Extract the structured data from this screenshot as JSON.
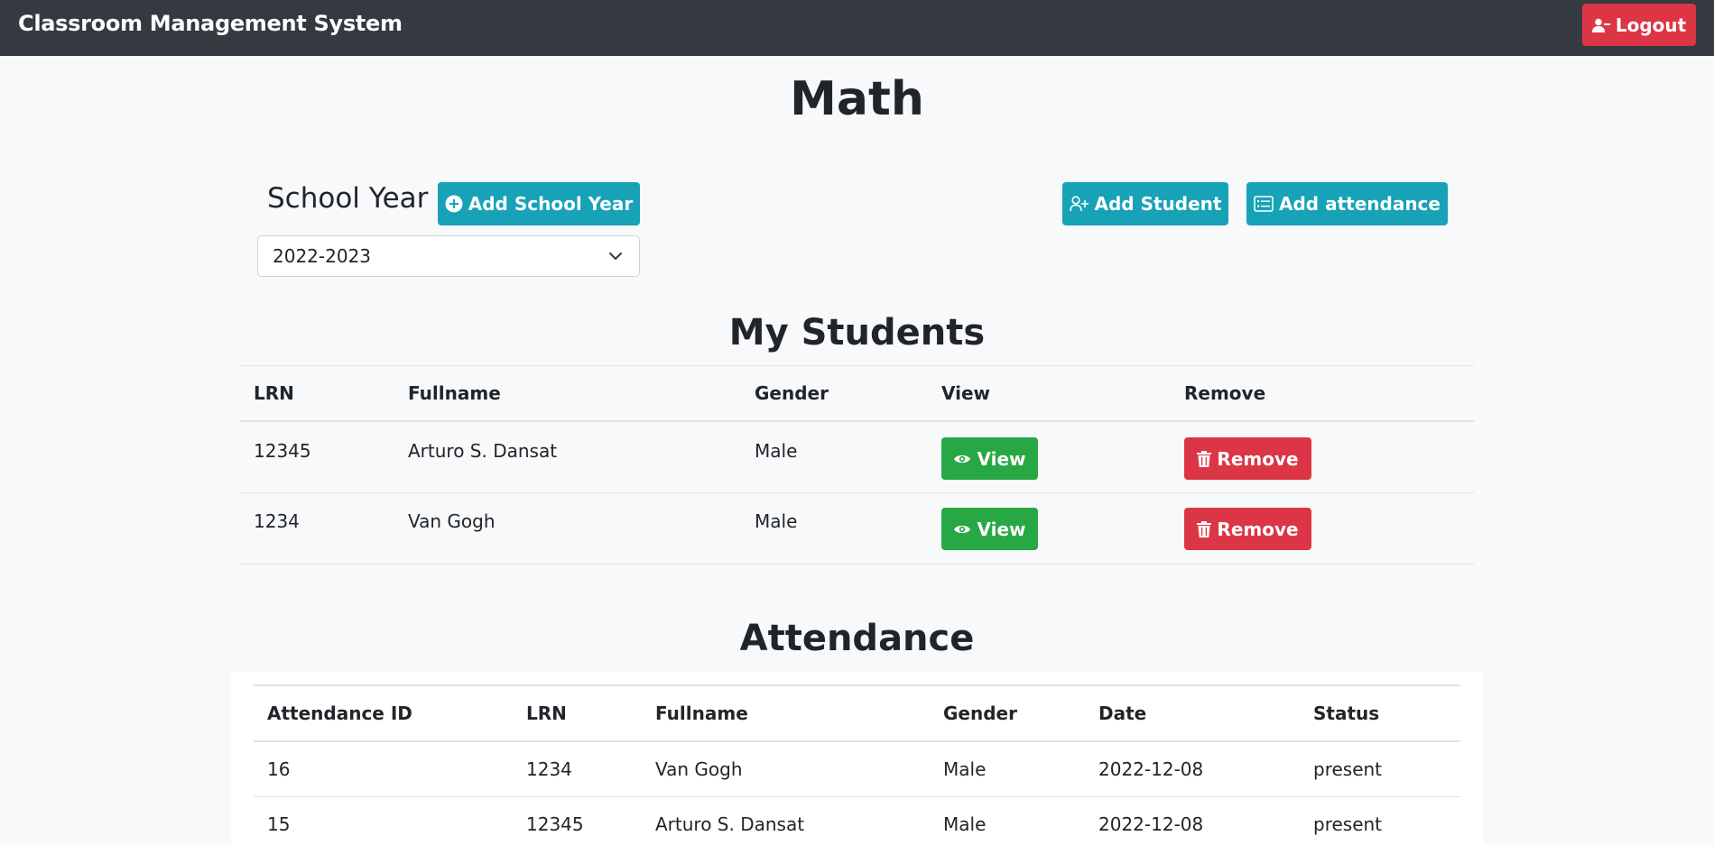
{
  "navbar": {
    "brand": "Classroom Management System",
    "logout_label": "Logout"
  },
  "page": {
    "title": "Math"
  },
  "school_year": {
    "label": "School Year",
    "add_button": "Add School Year",
    "selected": "2022-2023"
  },
  "actions": {
    "add_student": "Add Student",
    "add_attendance": "Add attendance"
  },
  "students": {
    "title": "My Students",
    "columns": [
      "LRN",
      "Fullname",
      "Gender",
      "View",
      "Remove"
    ],
    "rows": [
      {
        "lrn": "12345",
        "fullname": "Arturo S. Dansat",
        "gender": "Male",
        "view": "View",
        "remove": "Remove"
      },
      {
        "lrn": "1234",
        "fullname": "Van Gogh",
        "gender": "Male",
        "view": "View",
        "remove": "Remove"
      }
    ]
  },
  "attendance": {
    "title": "Attendance",
    "columns": [
      "Attendance ID",
      "LRN",
      "Fullname",
      "Gender",
      "Date",
      "Status"
    ],
    "rows": [
      {
        "id": "16",
        "lrn": "1234",
        "fullname": "Van Gogh",
        "gender": "Male",
        "date": "2022-12-08",
        "status": "present"
      },
      {
        "id": "15",
        "lrn": "12345",
        "fullname": "Arturo S. Dansat",
        "gender": "Male",
        "date": "2022-12-08",
        "status": "present"
      }
    ]
  }
}
